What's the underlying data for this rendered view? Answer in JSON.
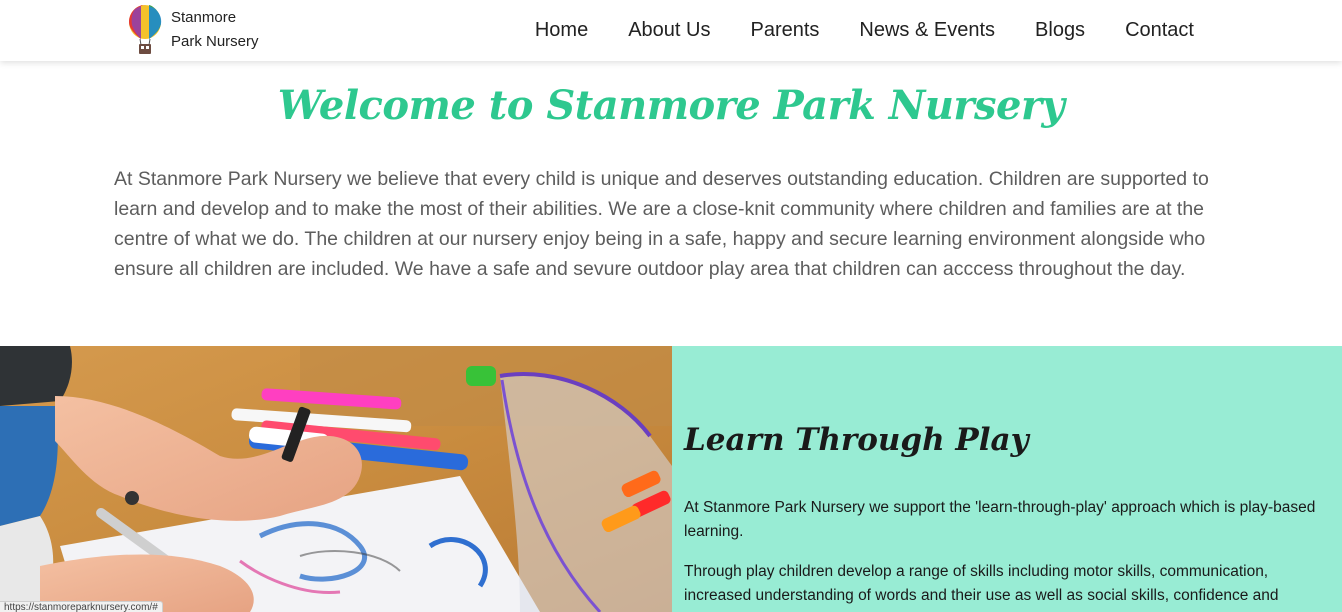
{
  "brand": {
    "line1": "Stanmore",
    "line2": "Park Nursery",
    "logo_icon": "hot-air-balloon-icon"
  },
  "nav": {
    "items": [
      {
        "label": "Home"
      },
      {
        "label": "About Us"
      },
      {
        "label": "Parents"
      },
      {
        "label": "News & Events"
      },
      {
        "label": "Blogs"
      },
      {
        "label": "Contact"
      }
    ]
  },
  "welcome": {
    "title": "Welcome to Stanmore Park Nursery",
    "body": "At Stanmore Park Nursery we believe that every child is unique and deserves outstanding education. Children are supported to learn and develop and to make the most of their abilities. We are a close-knit community where children and families are at the centre of what we do. The children at our nursery enjoy being in a safe, happy and secure learning environment alongside who ensure all children are included. We have a safe and sevure outdoor play area that children can acccess throughout the day."
  },
  "learn": {
    "title": "Learn Through Play",
    "p1": "At Stanmore Park Nursery we support the 'learn-through-play' approach which is play-based learning.",
    "p2": "Through play children develop a range of skills including motor skills, communication, increased understanding of words and their use as well as social skills, confidence and"
  },
  "status_bar": {
    "url": "https://stanmoreparknursery.com/#"
  },
  "colors": {
    "accent": "#2ec88f",
    "panel": "#98ecd4",
    "text": "#5d5d5d"
  }
}
